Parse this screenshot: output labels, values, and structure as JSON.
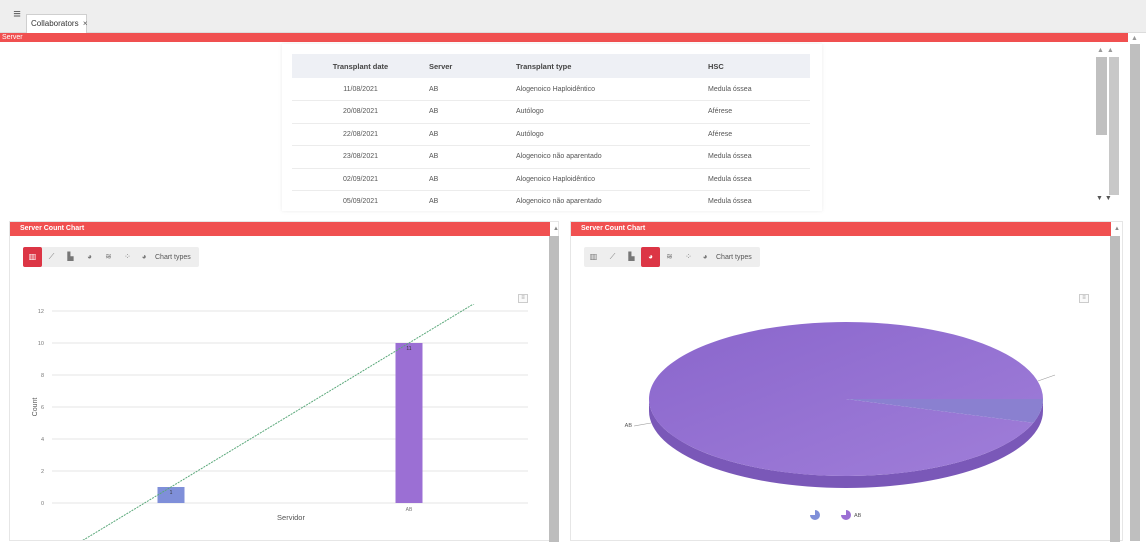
{
  "tabs": [
    {
      "label": "Collaborators",
      "close": "×"
    }
  ],
  "server_bar": {
    "label": "Server"
  },
  "table": {
    "headers": [
      "Transplant date",
      "Server",
      "Transplant type",
      "HSC"
    ],
    "rows": [
      [
        "11/08/2021",
        "AB",
        "Alogenoico Haploidêntico",
        "Medula óssea"
      ],
      [
        "20/08/2021",
        "AB",
        "Autólogo",
        "Aférese"
      ],
      [
        "22/08/2021",
        "AB",
        "Autólogo",
        "Aférese"
      ],
      [
        "23/08/2021",
        "AB",
        "Alogenoico não aparentado",
        "Medula óssea"
      ],
      [
        "02/09/2021",
        "AB",
        "Alogenoico Haploidêntico",
        "Medula óssea"
      ],
      [
        "05/09/2021",
        "AB",
        "Alogenoico não aparentado",
        "Medula óssea"
      ]
    ]
  },
  "left_panel": {
    "title": "Server Count Chart",
    "chart_types_label": "Chart types"
  },
  "right_panel": {
    "title": "Server Count Chart",
    "chart_types_label": "Chart types"
  },
  "colors": {
    "accent": "#f05050",
    "active_button": "#dc3545",
    "bar_small": "#7f8fd9",
    "bar_large": "#9b6fd4",
    "pie": "#9570d0"
  },
  "icons": [
    "bar-chart-icon",
    "line-chart-icon",
    "area-chart-icon",
    "pie-chart-icon",
    "stacked-icon",
    "scatter-icon",
    "chart-types-icon",
    "chart-menu-icon"
  ],
  "chart_data": [
    {
      "type": "bar",
      "title": "",
      "categories": [
        "",
        "AB"
      ],
      "values": [
        1,
        10
      ],
      "data_labels": [
        "1",
        "11"
      ],
      "xlabel": "Servidor",
      "ylabel": "Count",
      "ylim": [
        0,
        12
      ],
      "yticks": [
        0,
        2,
        4,
        6,
        8,
        10,
        12
      ],
      "trendline": {
        "from": [
          0,
          1
        ],
        "to": [
          1,
          10
        ]
      },
      "grid": true
    },
    {
      "type": "pie",
      "title": "",
      "categories": [
        "AB",
        ""
      ],
      "values": [
        95,
        5
      ],
      "slice_labels": [
        "AB"
      ],
      "legend": [
        {
          "name": ""
        },
        {
          "name": "AB"
        }
      ],
      "legend_position": "bottom"
    }
  ]
}
